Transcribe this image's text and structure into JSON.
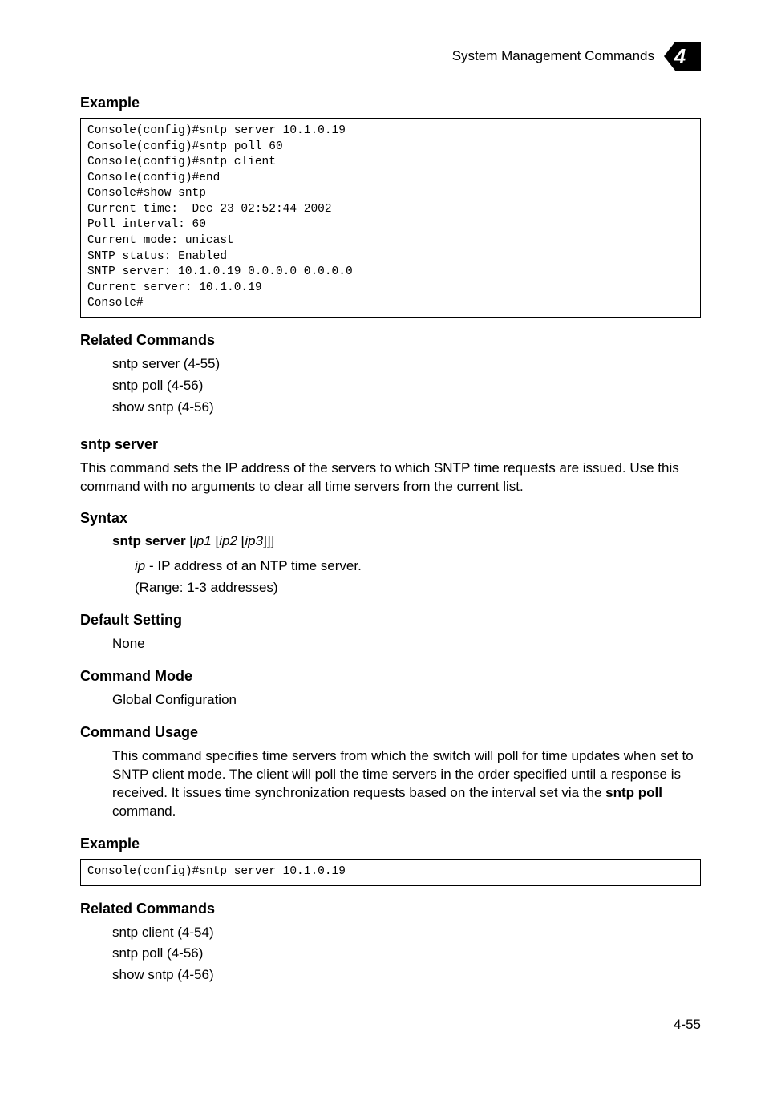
{
  "header": {
    "section": "System Management Commands",
    "chapter": "4"
  },
  "sec1": {
    "title": "Example",
    "code": "Console(config)#sntp server 10.1.0.19\nConsole(config)#sntp poll 60\nConsole(config)#sntp client\nConsole(config)#end\nConsole#show sntp\nCurrent time:  Dec 23 02:52:44 2002\nPoll interval: 60\nCurrent mode: unicast\nSNTP status: Enabled\nSNTP server: 10.1.0.19 0.0.0.0 0.0.0.0\nCurrent server: 10.1.0.19\nConsole#"
  },
  "sec2": {
    "title": "Related Commands",
    "l1": "sntp server (4-55)",
    "l2": "sntp poll (4-56)",
    "l3": "show sntp (4-56)"
  },
  "cmd": {
    "name": "sntp server",
    "desc": "This command sets the IP address of the servers to which SNTP time requests are issued. Use this command with no arguments to clear all time servers from the current list."
  },
  "syntax": {
    "title": "Syntax",
    "linebold": "sntp server",
    "lineargs": " [ip1 [ip2 [ip3]]]",
    "ipword": "ip",
    "ipdesc": " - IP address of an NTP time server.",
    "range": "(Range: 1-3 addresses)"
  },
  "defaultSetting": {
    "title": "Default Setting",
    "value": "None"
  },
  "mode": {
    "title": "Command Mode",
    "value": "Global Configuration"
  },
  "usage": {
    "title": "Command Usage",
    "text1": "This command specifies time servers from which the switch will poll for time updates when set to SNTP client mode. The client will poll the time servers in the order specified until a response is received. It issues time synchronization requests based on the interval set via the ",
    "boldcmd": "sntp poll",
    "text2": " command."
  },
  "example2": {
    "title": "Example",
    "code": "Console(config)#sntp server 10.1.0.19"
  },
  "related2": {
    "title": "Related Commands",
    "l1": "sntp client (4-54)",
    "l2": "sntp poll (4-56)",
    "l3": "show sntp (4-56)"
  },
  "pagenum": "4-55"
}
